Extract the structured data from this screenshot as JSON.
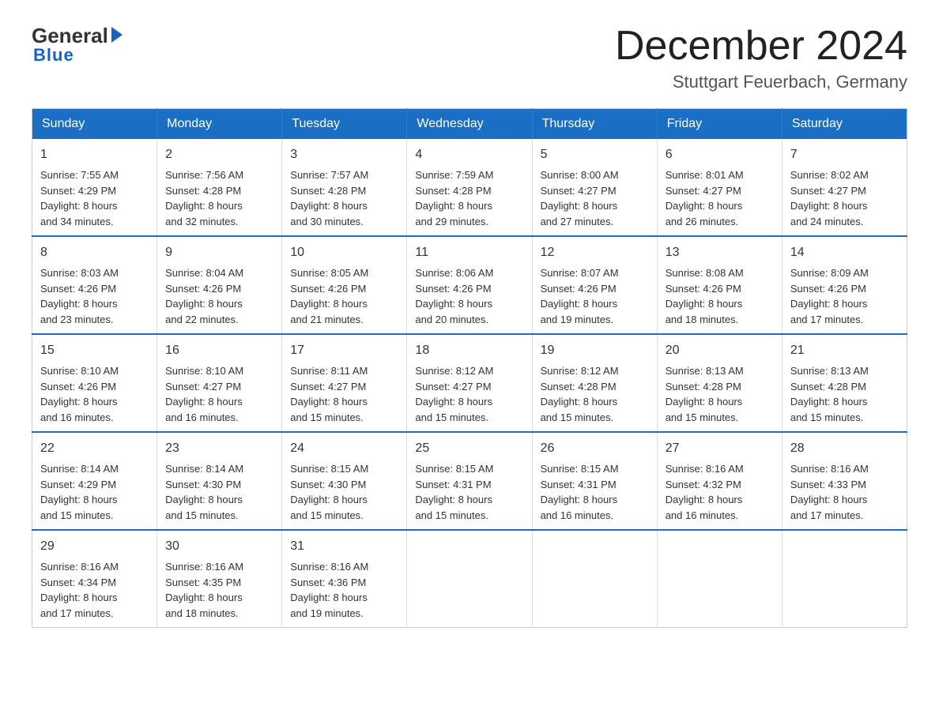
{
  "header": {
    "logo": {
      "general": "General",
      "blue": "Blue",
      "underline": "Blue"
    },
    "title": "December 2024",
    "location": "Stuttgart Feuerbach, Germany"
  },
  "days_of_week": [
    "Sunday",
    "Monday",
    "Tuesday",
    "Wednesday",
    "Thursday",
    "Friday",
    "Saturday"
  ],
  "weeks": [
    [
      {
        "day": "1",
        "sunrise": "7:55 AM",
        "sunset": "4:29 PM",
        "daylight_hours": "8 hours",
        "daylight_minutes": "and 34 minutes."
      },
      {
        "day": "2",
        "sunrise": "7:56 AM",
        "sunset": "4:28 PM",
        "daylight_hours": "8 hours",
        "daylight_minutes": "and 32 minutes."
      },
      {
        "day": "3",
        "sunrise": "7:57 AM",
        "sunset": "4:28 PM",
        "daylight_hours": "8 hours",
        "daylight_minutes": "and 30 minutes."
      },
      {
        "day": "4",
        "sunrise": "7:59 AM",
        "sunset": "4:28 PM",
        "daylight_hours": "8 hours",
        "daylight_minutes": "and 29 minutes."
      },
      {
        "day": "5",
        "sunrise": "8:00 AM",
        "sunset": "4:27 PM",
        "daylight_hours": "8 hours",
        "daylight_minutes": "and 27 minutes."
      },
      {
        "day": "6",
        "sunrise": "8:01 AM",
        "sunset": "4:27 PM",
        "daylight_hours": "8 hours",
        "daylight_minutes": "and 26 minutes."
      },
      {
        "day": "7",
        "sunrise": "8:02 AM",
        "sunset": "4:27 PM",
        "daylight_hours": "8 hours",
        "daylight_minutes": "and 24 minutes."
      }
    ],
    [
      {
        "day": "8",
        "sunrise": "8:03 AM",
        "sunset": "4:26 PM",
        "daylight_hours": "8 hours",
        "daylight_minutes": "and 23 minutes."
      },
      {
        "day": "9",
        "sunrise": "8:04 AM",
        "sunset": "4:26 PM",
        "daylight_hours": "8 hours",
        "daylight_minutes": "and 22 minutes."
      },
      {
        "day": "10",
        "sunrise": "8:05 AM",
        "sunset": "4:26 PM",
        "daylight_hours": "8 hours",
        "daylight_minutes": "and 21 minutes."
      },
      {
        "day": "11",
        "sunrise": "8:06 AM",
        "sunset": "4:26 PM",
        "daylight_hours": "8 hours",
        "daylight_minutes": "and 20 minutes."
      },
      {
        "day": "12",
        "sunrise": "8:07 AM",
        "sunset": "4:26 PM",
        "daylight_hours": "8 hours",
        "daylight_minutes": "and 19 minutes."
      },
      {
        "day": "13",
        "sunrise": "8:08 AM",
        "sunset": "4:26 PM",
        "daylight_hours": "8 hours",
        "daylight_minutes": "and 18 minutes."
      },
      {
        "day": "14",
        "sunrise": "8:09 AM",
        "sunset": "4:26 PM",
        "daylight_hours": "8 hours",
        "daylight_minutes": "and 17 minutes."
      }
    ],
    [
      {
        "day": "15",
        "sunrise": "8:10 AM",
        "sunset": "4:26 PM",
        "daylight_hours": "8 hours",
        "daylight_minutes": "and 16 minutes."
      },
      {
        "day": "16",
        "sunrise": "8:10 AM",
        "sunset": "4:27 PM",
        "daylight_hours": "8 hours",
        "daylight_minutes": "and 16 minutes."
      },
      {
        "day": "17",
        "sunrise": "8:11 AM",
        "sunset": "4:27 PM",
        "daylight_hours": "8 hours",
        "daylight_minutes": "and 15 minutes."
      },
      {
        "day": "18",
        "sunrise": "8:12 AM",
        "sunset": "4:27 PM",
        "daylight_hours": "8 hours",
        "daylight_minutes": "and 15 minutes."
      },
      {
        "day": "19",
        "sunrise": "8:12 AM",
        "sunset": "4:28 PM",
        "daylight_hours": "8 hours",
        "daylight_minutes": "and 15 minutes."
      },
      {
        "day": "20",
        "sunrise": "8:13 AM",
        "sunset": "4:28 PM",
        "daylight_hours": "8 hours",
        "daylight_minutes": "and 15 minutes."
      },
      {
        "day": "21",
        "sunrise": "8:13 AM",
        "sunset": "4:28 PM",
        "daylight_hours": "8 hours",
        "daylight_minutes": "and 15 minutes."
      }
    ],
    [
      {
        "day": "22",
        "sunrise": "8:14 AM",
        "sunset": "4:29 PM",
        "daylight_hours": "8 hours",
        "daylight_minutes": "and 15 minutes."
      },
      {
        "day": "23",
        "sunrise": "8:14 AM",
        "sunset": "4:30 PM",
        "daylight_hours": "8 hours",
        "daylight_minutes": "and 15 minutes."
      },
      {
        "day": "24",
        "sunrise": "8:15 AM",
        "sunset": "4:30 PM",
        "daylight_hours": "8 hours",
        "daylight_minutes": "and 15 minutes."
      },
      {
        "day": "25",
        "sunrise": "8:15 AM",
        "sunset": "4:31 PM",
        "daylight_hours": "8 hours",
        "daylight_minutes": "and 15 minutes."
      },
      {
        "day": "26",
        "sunrise": "8:15 AM",
        "sunset": "4:31 PM",
        "daylight_hours": "8 hours",
        "daylight_minutes": "and 16 minutes."
      },
      {
        "day": "27",
        "sunrise": "8:16 AM",
        "sunset": "4:32 PM",
        "daylight_hours": "8 hours",
        "daylight_minutes": "and 16 minutes."
      },
      {
        "day": "28",
        "sunrise": "8:16 AM",
        "sunset": "4:33 PM",
        "daylight_hours": "8 hours",
        "daylight_minutes": "and 17 minutes."
      }
    ],
    [
      {
        "day": "29",
        "sunrise": "8:16 AM",
        "sunset": "4:34 PM",
        "daylight_hours": "8 hours",
        "daylight_minutes": "and 17 minutes."
      },
      {
        "day": "30",
        "sunrise": "8:16 AM",
        "sunset": "4:35 PM",
        "daylight_hours": "8 hours",
        "daylight_minutes": "and 18 minutes."
      },
      {
        "day": "31",
        "sunrise": "8:16 AM",
        "sunset": "4:36 PM",
        "daylight_hours": "8 hours",
        "daylight_minutes": "and 19 minutes."
      },
      null,
      null,
      null,
      null
    ]
  ],
  "labels": {
    "sunrise": "Sunrise:",
    "sunset": "Sunset:",
    "daylight": "Daylight:"
  }
}
